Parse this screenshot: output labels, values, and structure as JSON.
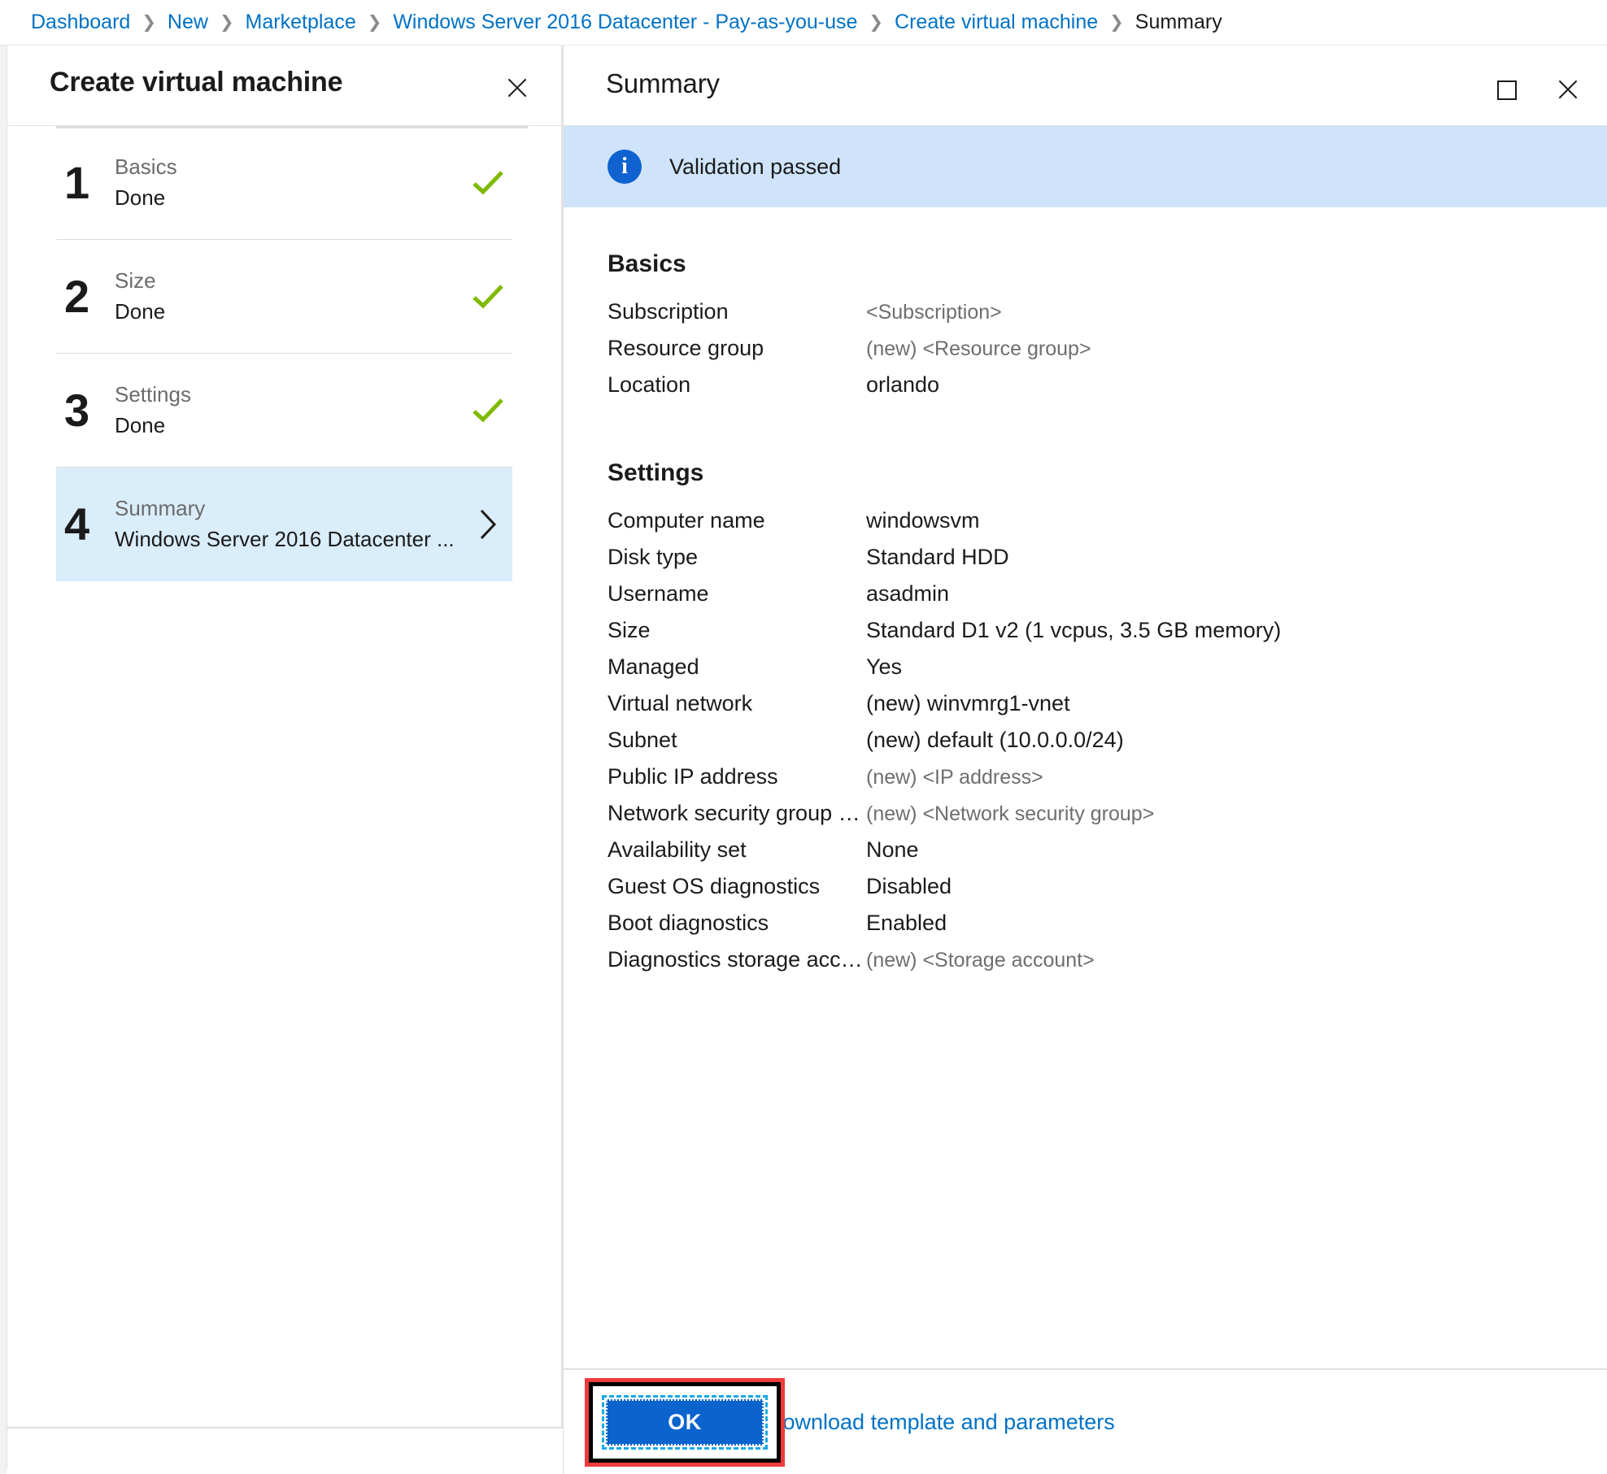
{
  "breadcrumb": {
    "items": [
      {
        "label": "Dashboard",
        "current": false
      },
      {
        "label": "New",
        "current": false
      },
      {
        "label": "Marketplace",
        "current": false
      },
      {
        "label": "Windows Server 2016 Datacenter - Pay-as-you-use",
        "current": false
      },
      {
        "label": "Create virtual machine",
        "current": false
      },
      {
        "label": "Summary",
        "current": true
      }
    ],
    "separator": "❯"
  },
  "left_blade": {
    "title": "Create virtual machine",
    "close_label": "Close",
    "steps": [
      {
        "number": "1",
        "label": "Basics",
        "sub": "Done",
        "state": "done",
        "mark": "check-icon"
      },
      {
        "number": "2",
        "label": "Size",
        "sub": "Done",
        "state": "done",
        "mark": "check-icon"
      },
      {
        "number": "3",
        "label": "Settings",
        "sub": "Done",
        "state": "done",
        "mark": "check-icon"
      },
      {
        "number": "4",
        "label": "Summary",
        "sub": "Windows Server 2016 Datacenter ...",
        "state": "active",
        "mark": "chevron-right-icon"
      }
    ]
  },
  "right_blade": {
    "title": "Summary",
    "maximize_label": "Maximize",
    "close_label": "Close",
    "validation": {
      "icon": "info-icon",
      "text": "Validation passed"
    },
    "sections": [
      {
        "title": "Basics",
        "rows": [
          {
            "key": "Subscription",
            "value": "<Subscription>",
            "placeholder": true
          },
          {
            "key": "Resource group",
            "value": "(new) <Resource group>",
            "placeholder": true
          },
          {
            "key": "Location",
            "value": "orlando",
            "placeholder": false
          }
        ]
      },
      {
        "title": "Settings",
        "rows": [
          {
            "key": "Computer name",
            "value": "windowsvm",
            "placeholder": false
          },
          {
            "key": "Disk type",
            "value": "Standard HDD",
            "placeholder": false
          },
          {
            "key": "Username",
            "value": "asadmin",
            "placeholder": false
          },
          {
            "key": "Size",
            "value": "Standard D1 v2 (1 vcpus, 3.5 GB memory)",
            "placeholder": false
          },
          {
            "key": "Managed",
            "value": "Yes",
            "placeholder": false
          },
          {
            "key": "Virtual network",
            "value": "(new) winvmrg1-vnet",
            "placeholder": false
          },
          {
            "key": "Subnet",
            "value": "(new) default (10.0.0.0/24)",
            "placeholder": false
          },
          {
            "key": "Public IP address",
            "value": "(new) <IP address>",
            "placeholder": true
          },
          {
            "key": "Network security group (fire...",
            "value": "(new) <Network security group>",
            "placeholder": true
          },
          {
            "key": "Availability set",
            "value": "None",
            "placeholder": false
          },
          {
            "key": "Guest OS diagnostics",
            "value": "Disabled",
            "placeholder": false
          },
          {
            "key": "Boot diagnostics",
            "value": "Enabled",
            "placeholder": false
          },
          {
            "key": "Diagnostics storage account",
            "value": "(new) <Storage account>",
            "placeholder": true
          }
        ]
      }
    ],
    "footer": {
      "ok_label": "OK",
      "download_label": "Download template and parameters"
    }
  },
  "colors": {
    "link": "#0072c6",
    "accent_blue": "#0b63ce",
    "info_blue": "#0f62d0",
    "banner_blue": "#cfe4fa",
    "active_step_blue": "#daedfb",
    "check_green": "#7fba00",
    "highlight_red": "#ee3b3b",
    "focus_cyan": "#17a9e8"
  }
}
